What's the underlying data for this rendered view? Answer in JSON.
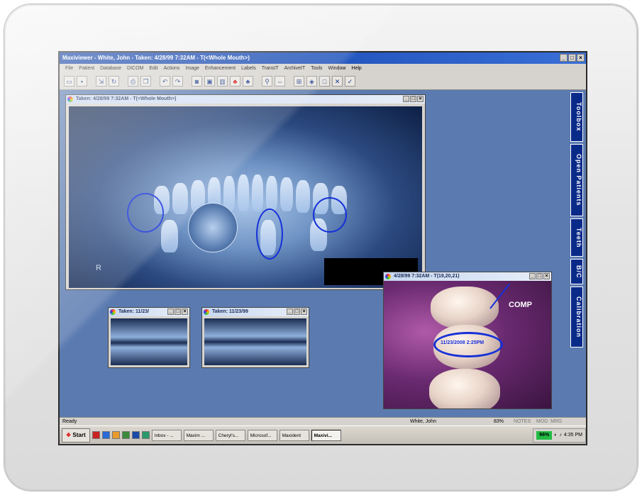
{
  "app": {
    "title": "Maxiviewer - White, John - Taken: 4/28/99  7:32AM - T(<Whole Mouth>)"
  },
  "menu": [
    "File",
    "Patient",
    "Database",
    "DICOM",
    "Edit",
    "Actions",
    "Image",
    "Enhancement",
    "Labels",
    "TransIT",
    "ArchiveIT",
    "Tools",
    "Window",
    "Help"
  ],
  "side_tabs": [
    "Toolbox",
    "Open Patients",
    "Teeth",
    "B/C",
    "Calibration"
  ],
  "windows": {
    "pano": {
      "title": "Taken: 4/28/99  7:32AM - T(<Whole Mouth>)",
      "marker": "R"
    },
    "bitewing1": {
      "title": "Taken: 11/23/"
    },
    "bitewing2": {
      "title": "Taken: 11/23/99"
    },
    "intraoral": {
      "title": "4/28/99  7:32AM - T(19,20,21)",
      "label_comp": "COMP",
      "date_annotation": "11/23/2008  2:25PM"
    }
  },
  "status": {
    "left": "Ready",
    "patient": "White, John",
    "zoom": "83%",
    "notes": "NOTES",
    "mod": "MOD",
    "mrg": "MRG"
  },
  "taskbar": {
    "start": "Start",
    "tasks": [
      "Inbox - ...",
      "Maxim ...",
      "Cheryl's...",
      "Microsof...",
      "Maxident",
      "Maxivi..."
    ],
    "battery": "96%",
    "clock": "4:35 PM"
  },
  "colors": {
    "workspace": "#5b7bb0",
    "annotation": "#1530d8",
    "side_tab": "#0a2a8a"
  }
}
